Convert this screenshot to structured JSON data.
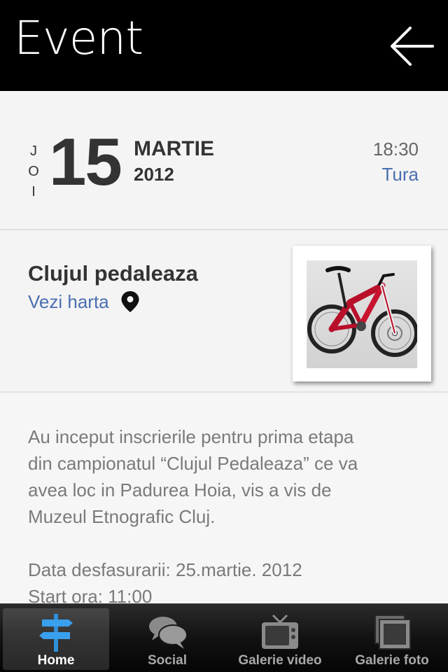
{
  "header": {
    "title": "Event",
    "back_icon": "back-arrow-icon"
  },
  "date": {
    "weekday_letters": [
      "J",
      "O",
      "I"
    ],
    "day": "15",
    "month": "MARTIE",
    "year": "2012",
    "time": "18:30",
    "tag": "Tura"
  },
  "event": {
    "name": "Clujul pedaleaza",
    "map_link": "Vezi harta",
    "map_icon": "map-pin-icon",
    "photo_icon": "bicycle-photo"
  },
  "description": {
    "paragraph1": [
      "Au inceput inscrierile pentru prima etapa",
      "din campionatul “Clujul Pedaleaza” ce va",
      "avea loc in Padurea Hoia, vis a vis de",
      "Muzeul Etnografic Cluj."
    ],
    "paragraph2": [
      "Data desfasurarii: 25.martie. 2012",
      "Start ora: 11:00"
    ]
  },
  "tabbar": {
    "tabs": [
      {
        "label": "Home",
        "icon": "signpost-icon",
        "active": true
      },
      {
        "label": "Social",
        "icon": "chat-bubbles-icon",
        "active": false
      },
      {
        "label": "Galerie video",
        "icon": "tv-icon",
        "active": false
      },
      {
        "label": "Galerie foto",
        "icon": "photos-icon",
        "active": false
      }
    ]
  },
  "colors": {
    "header_bg": "#000000",
    "link": "#4a6fb0",
    "text_dark": "#333333",
    "text_muted": "#7a7a7a",
    "tab_active_icon": "#2f8fd8"
  }
}
